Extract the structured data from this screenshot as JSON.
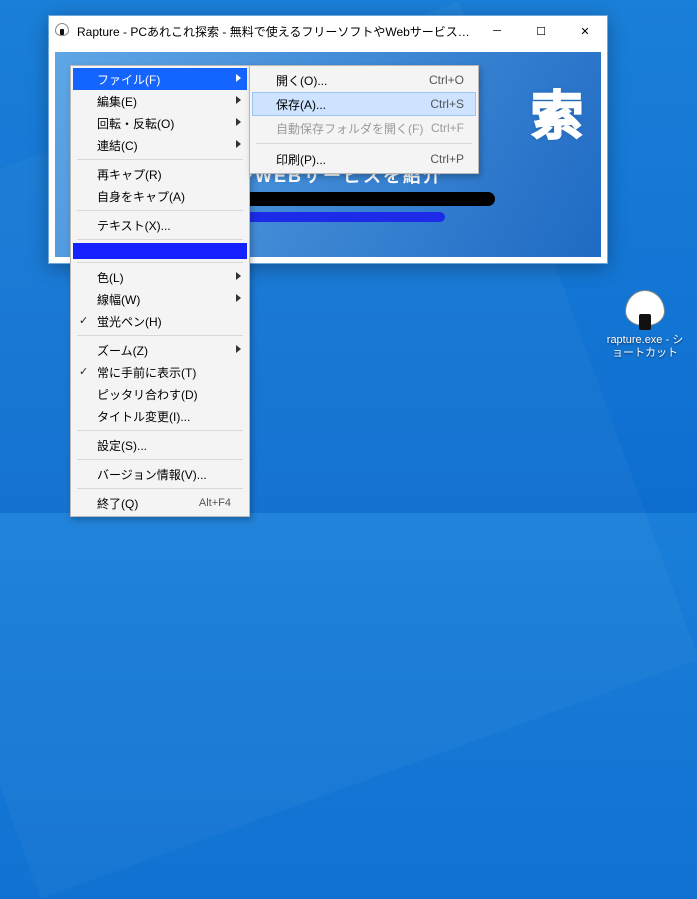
{
  "window": {
    "title": "Rapture - PCあれこれ探索 - 無料で使えるフリーソフトやWebサービスを毎日紹介　...",
    "content_big": "索",
    "content_mid": "ソフトやWEBサービスを紹介"
  },
  "desktop_icon_label": "rapture.exe - ショートカット",
  "menu": {
    "file": "ファイル(F)",
    "edit": "編集(E)",
    "rotate": "回転・反転(O)",
    "link": "連結(C)",
    "recap": "再キャプ(R)",
    "selfcap": "自身をキャプ(A)",
    "text": "テキスト(X)...",
    "color": "色(L)",
    "line": "線幅(W)",
    "highlighter": "蛍光ペン(H)",
    "zoom": "ズーム(Z)",
    "topmost": "常に手前に表示(T)",
    "fit": "ピッタリ合わす(D)",
    "title_change": "タイトル変更(I)...",
    "settings": "設定(S)...",
    "version": "バージョン情報(V)...",
    "exit": "終了(Q)",
    "exit_shortcut": "Alt+F4"
  },
  "submenu": {
    "open": "開く(O)...",
    "open_sc": "Ctrl+O",
    "save": "保存(A)...",
    "save_sc": "Ctrl+S",
    "openfolder": "自動保存フォルダを開く(F)",
    "openfolder_sc": "Ctrl+F",
    "print": "印刷(P)...",
    "print_sc": "Ctrl+P"
  }
}
